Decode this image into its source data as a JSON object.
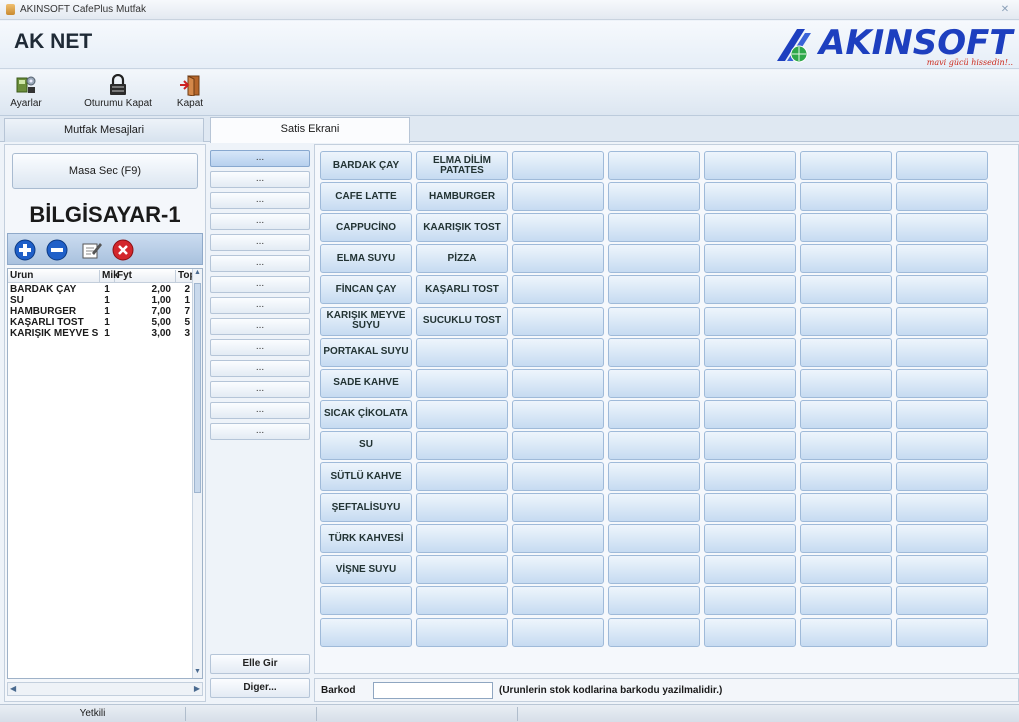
{
  "window": {
    "title": "AKINSOFT CafePlus Mutfak",
    "close_glyph": "✕"
  },
  "header": {
    "app_title": "AK NET",
    "brand": "AKINSOFT",
    "slogan": "mavi gücü hissedin!.."
  },
  "toolbar": {
    "settings_label": "Ayarlar",
    "logout_label": "Oturumu Kapat",
    "exit_label": "Kapat"
  },
  "tabs": {
    "messages": "Mutfak Mesajlari",
    "sales": "Satis Ekrani"
  },
  "left": {
    "table_select": "Masa Sec (F9)",
    "computer_name": "BİLGİSAYAR-1",
    "columns": [
      "Urun",
      "Mik",
      "Fyt",
      "Topla"
    ],
    "rows": [
      [
        "BARDAK ÇAY",
        "1",
        "2,00",
        "2"
      ],
      [
        "SU",
        "1",
        "1,00",
        "1"
      ],
      [
        "HAMBURGER",
        "1",
        "7,00",
        "7"
      ],
      [
        "KAŞARLI TOST",
        "1",
        "5,00",
        "5"
      ],
      [
        "KARIŞIK MEYVE S",
        "1",
        "3,00",
        "3"
      ]
    ]
  },
  "groups": {
    "items": [
      "...",
      "...",
      "...",
      "...",
      "...",
      "...",
      "...",
      "...",
      "...",
      "...",
      "...",
      "...",
      "...",
      "..."
    ],
    "manual_entry": "Elle Gir",
    "other": "Diger..."
  },
  "products": {
    "col1": [
      "BARDAK ÇAY",
      "CAFE LATTE",
      "CAPPUCİNO",
      "ELMA SUYU",
      "FİNCAN ÇAY",
      "KARIŞIK MEYVE SUYU",
      "PORTAKAL SUYU",
      "SADE KAHVE",
      "SICAK ÇİKOLATA",
      "SU",
      "SÜTLÜ KAHVE",
      "ŞEFTALİSUYU",
      "TÜRK KAHVESİ",
      "VİŞNE SUYU",
      "",
      ""
    ],
    "col2": [
      "ELMA DİLİM PATATES",
      "HAMBURGER",
      "KAARIŞIK TOST",
      "PİZZA",
      "KAŞARLI TOST",
      "SUCUKLU TOST",
      "",
      "",
      "",
      "",
      "",
      "",
      "",
      "",
      "",
      ""
    ]
  },
  "barcode": {
    "label": "Barkod",
    "value": "",
    "note": "(Urunlerin stok kodlarina barkodu yazilmalidir.)"
  },
  "status": {
    "user": "Yetkili"
  }
}
